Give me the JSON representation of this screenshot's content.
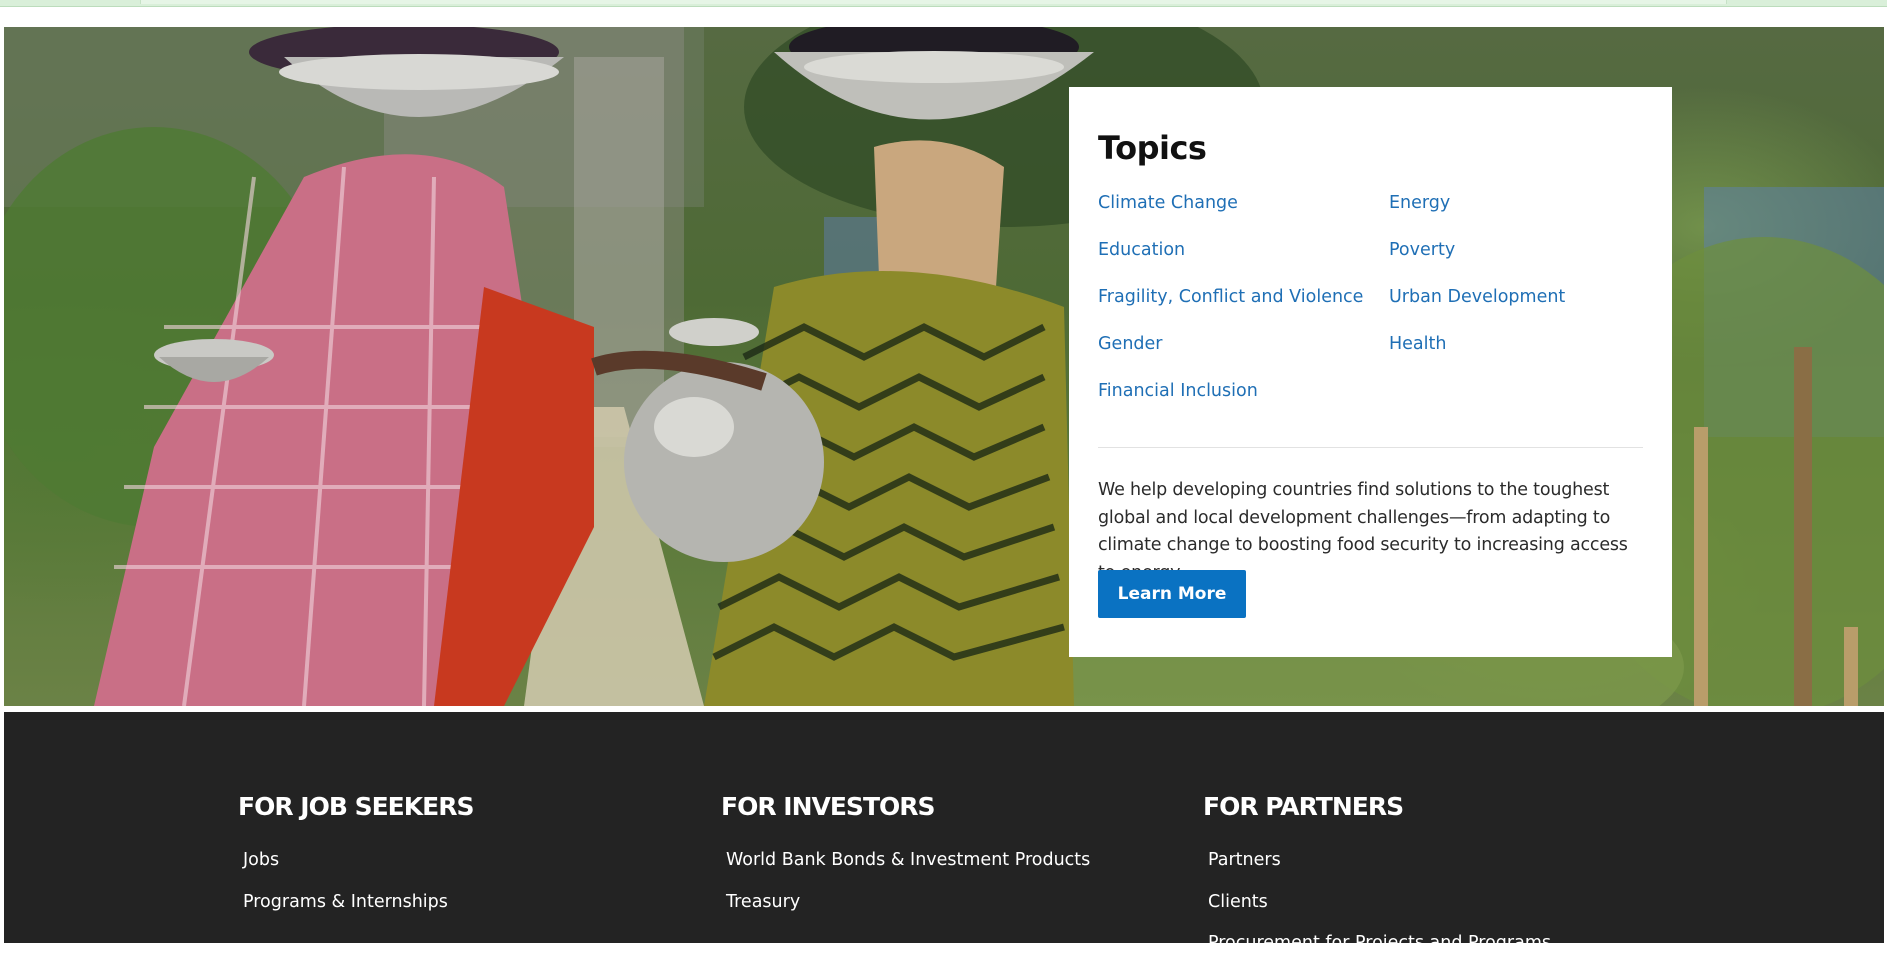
{
  "topics": {
    "title": "Topics",
    "links": [
      "Climate Change",
      "Energy",
      "Education",
      "Poverty",
      "Fragility, Conflict and Violence",
      "Urban Development",
      "Gender",
      "Health",
      "Financial Inclusion"
    ],
    "description": "We help developing countries find solutions to the toughest global and local development challenges—from adapting to climate change to boosting food security to increasing access to energy.",
    "button_label": "Learn More"
  },
  "footer": {
    "columns": [
      {
        "heading": "FOR JOB SEEKERS",
        "links": [
          "Jobs",
          "Programs & Internships"
        ]
      },
      {
        "heading": "FOR INVESTORS",
        "links": [
          "World Bank Bonds & Investment Products",
          "Treasury"
        ]
      },
      {
        "heading": "FOR PARTNERS",
        "links": [
          "Partners",
          "Clients",
          "Procurement for Projects and Programs"
        ]
      }
    ]
  },
  "colors": {
    "link": "#1f6fb5",
    "button": "#0a72c2",
    "footer_bg": "#232323"
  }
}
